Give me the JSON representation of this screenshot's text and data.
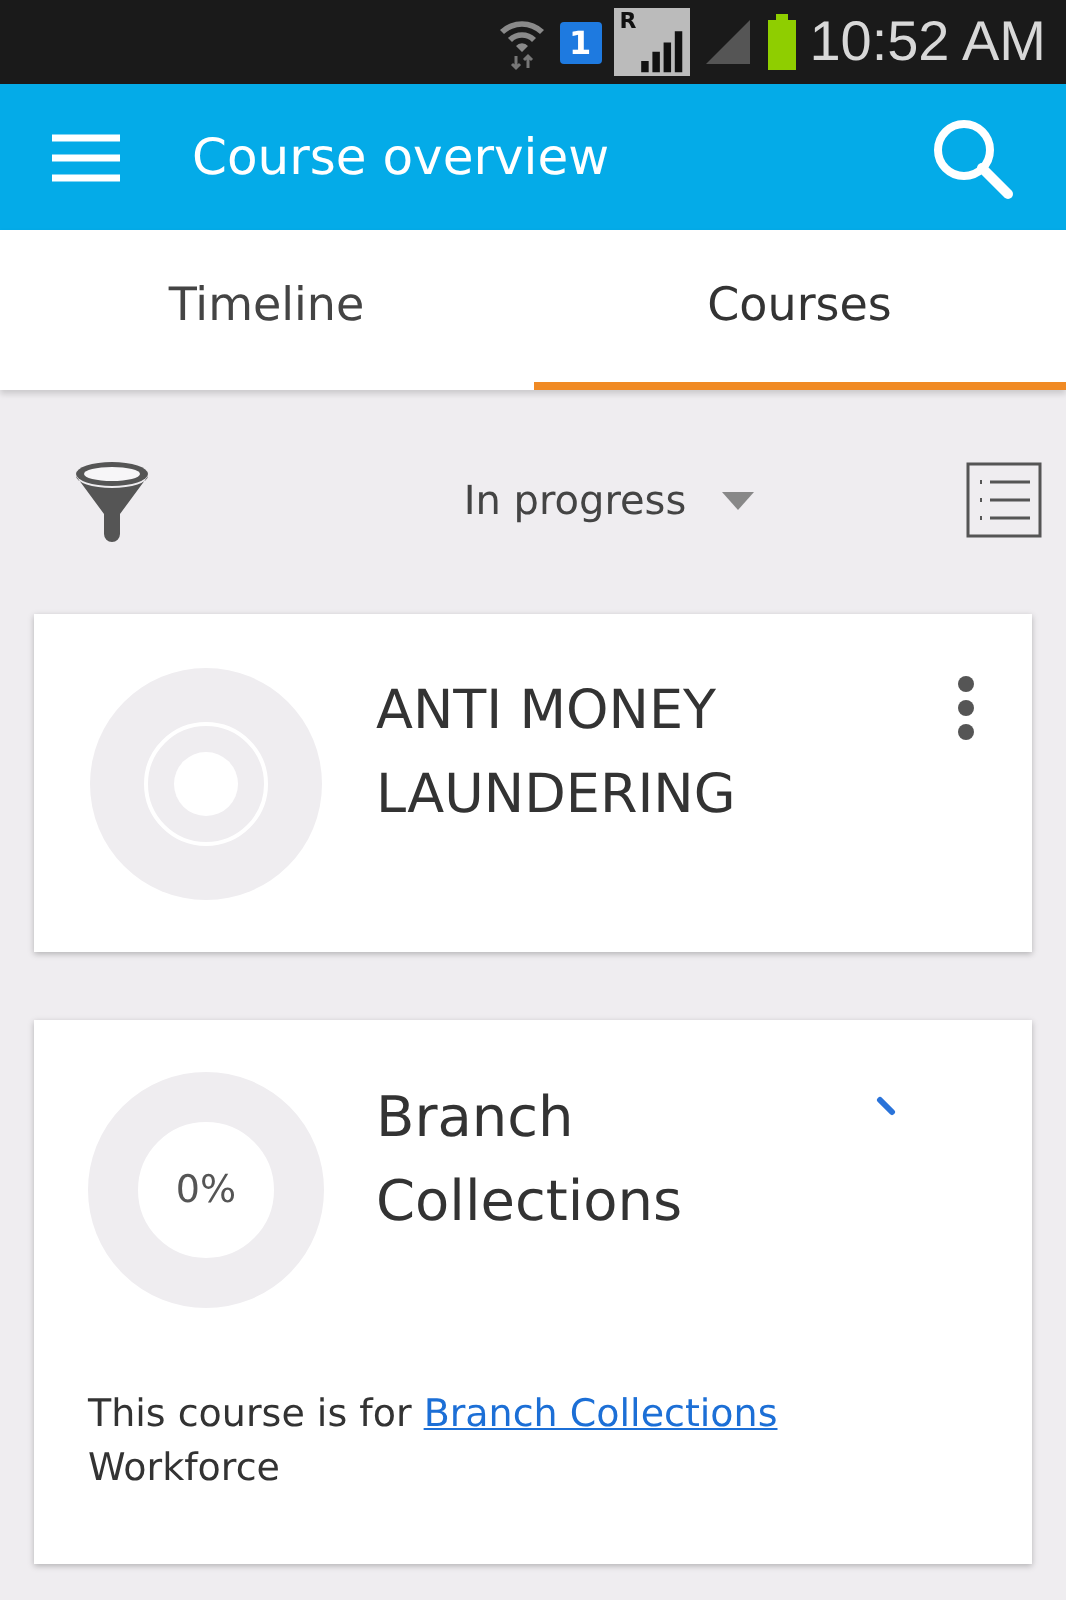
{
  "status_bar": {
    "sim": "1",
    "network_letter": "R",
    "time": "10:52 AM"
  },
  "app_bar": {
    "title": "Course overview"
  },
  "tabs": [
    {
      "label": "Timeline",
      "selected": false
    },
    {
      "label": "Courses",
      "selected": true
    }
  ],
  "filter": {
    "value": "In progress"
  },
  "courses": [
    {
      "kind": "loading",
      "title": "ANTI MONEY LAUNDERING"
    },
    {
      "kind": "progress",
      "title": "Branch Collections",
      "percent": "0%",
      "description": {
        "prefix": "This course is for",
        "link": "Branch Collections",
        "suffix": "Workforce"
      }
    }
  ]
}
